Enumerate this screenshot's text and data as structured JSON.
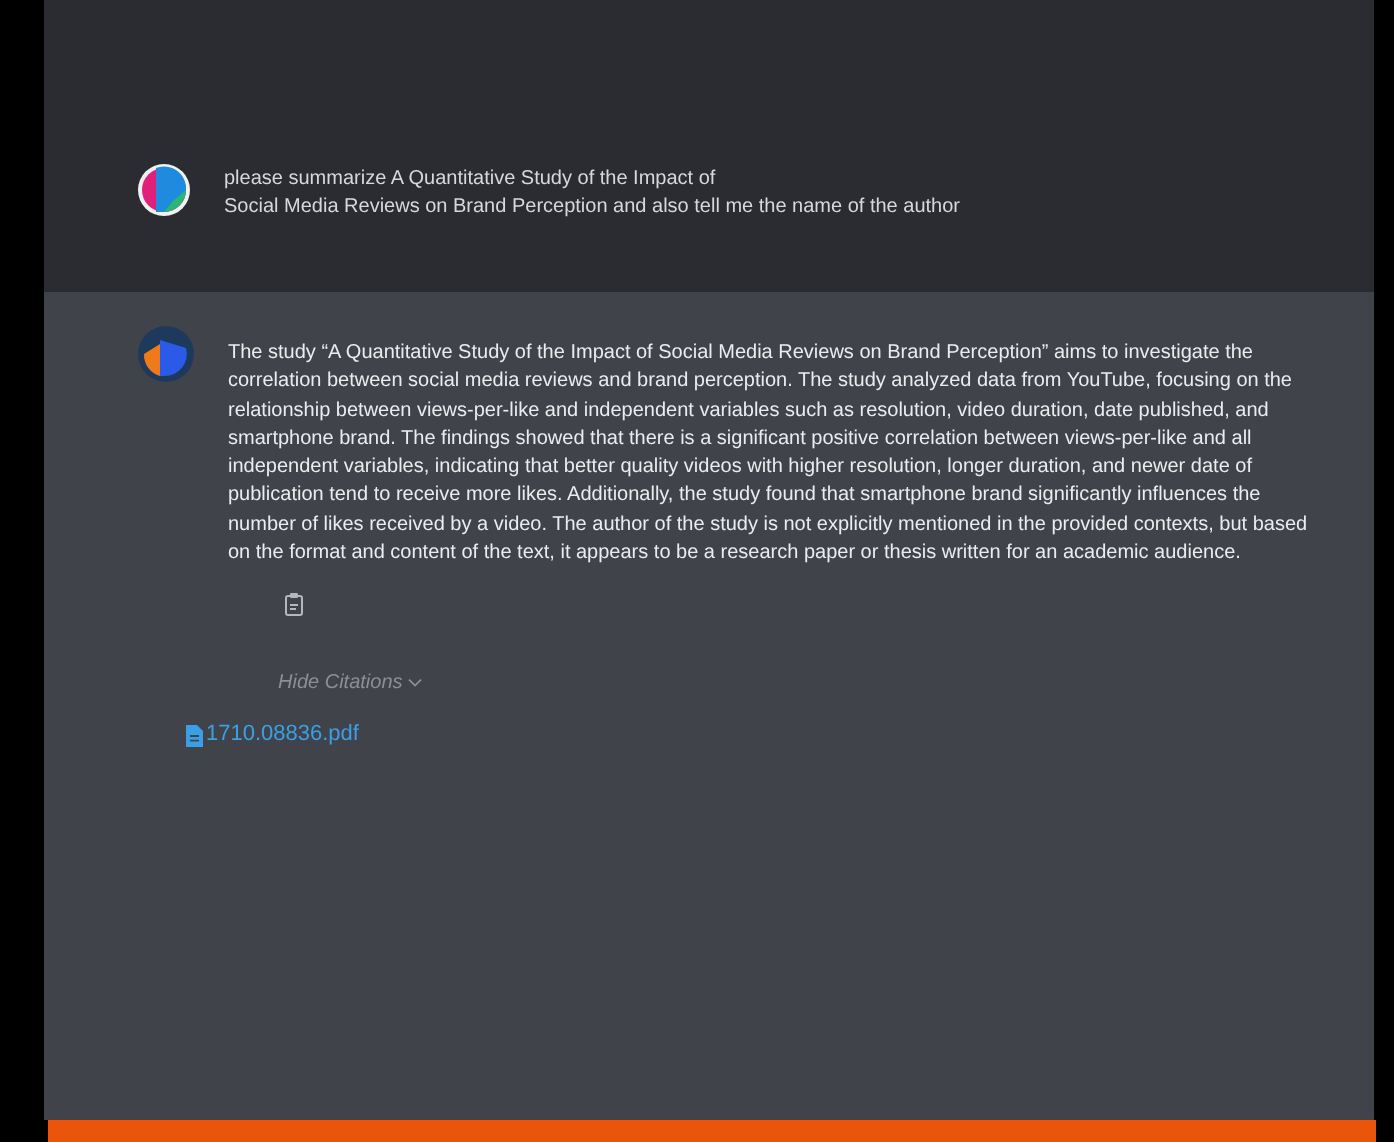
{
  "user_message": {
    "lines": [
      "please summarize A Quantitative Study of the Impact of",
      "Social Media Reviews on Brand Perception and also tell me the name of the author"
    ]
  },
  "assistant_message": {
    "text": "The study “A Quantitative Study of the Impact of Social Media Reviews on Brand Perception” aims to investigate the correlation between social media reviews and brand perception. The study analyzed data from YouTube, focusing on the relationship between views-per-like and independent variables such as resolution, video duration, date published, and smartphone brand. The findings showed that there is a significant positive correlation between views-per-like and all independent variables, indicating that better quality videos with higher resolution, longer duration, and newer date of publication tend to receive more likes. Additionally, the study found that smartphone brand significantly influences the number of likes received by a video. The author of the study is not explicitly mentioned in the provided contexts, but based on the format and content of the text, it appears to be a research paper or thesis written for an academic audience.",
    "citations_toggle": "Hide Citations",
    "citations_expanded": true,
    "citations": [
      "1710.08836.pdf"
    ]
  }
}
